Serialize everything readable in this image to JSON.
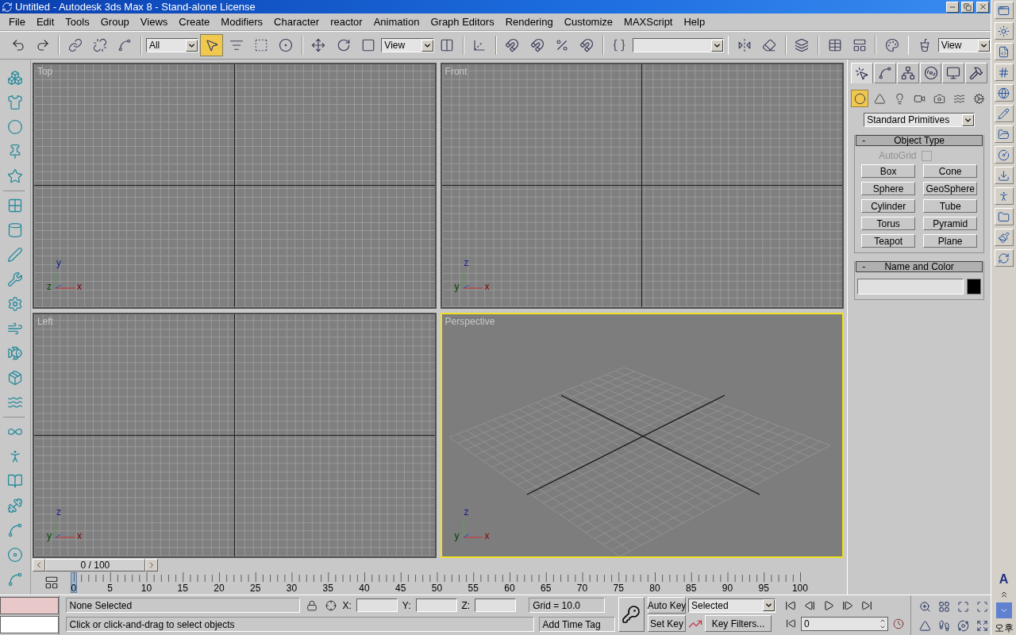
{
  "window": {
    "title": "Untitled - Autodesk 3ds Max 8  - Stand-alone License"
  },
  "menu": [
    "File",
    "Edit",
    "Tools",
    "Group",
    "Views",
    "Create",
    "Modifiers",
    "Character",
    "reactor",
    "Animation",
    "Graph Editors",
    "Rendering",
    "Customize",
    "MAXScript",
    "Help"
  ],
  "toolbar": {
    "selection_filter": "All",
    "reference_coordinate": "View",
    "render_view": "View",
    "tools": [
      {
        "selected": false
      },
      {
        "selected": false
      },
      {
        "selected": false
      },
      {
        "selected": false
      },
      {
        "selected": false
      },
      {
        "selected": true
      },
      {
        "selected": false
      },
      {
        "selected": false
      },
      {
        "selected": false
      },
      {
        "selected": false
      },
      {
        "selected": false
      },
      {
        "selected": false
      },
      {
        "selected": false
      },
      {
        "selected": false
      },
      {
        "selected": false
      },
      {
        "selected": false
      },
      {
        "selected": false
      },
      {
        "selected": false
      },
      {
        "selected": false
      },
      {
        "selected": false
      },
      {
        "selected": false
      },
      {
        "selected": false
      },
      {
        "selected": false
      },
      {
        "selected": false
      },
      {
        "selected": false
      },
      {
        "selected": false
      }
    ]
  },
  "viewports": [
    {
      "label": "Top",
      "active": false,
      "kind": "ortho",
      "axes": {
        "up": "y",
        "depth": "z",
        "right": "x"
      }
    },
    {
      "label": "Front",
      "active": false,
      "kind": "ortho",
      "axes": {
        "up": "z",
        "depth": "y",
        "right": "x"
      }
    },
    {
      "label": "Left",
      "active": false,
      "kind": "ortho",
      "axes": {
        "up": "z",
        "depth": "y",
        "right": "x"
      }
    },
    {
      "label": "Perspective",
      "active": true,
      "kind": "perspective",
      "axes": {
        "up": "z",
        "depth": "y",
        "right": "x"
      }
    }
  ],
  "command_panel": {
    "tabs": [
      {
        "selected": true
      },
      {
        "selected": false
      },
      {
        "selected": false
      },
      {
        "selected": false
      },
      {
        "selected": false
      },
      {
        "selected": false
      }
    ],
    "categories": [
      {
        "selected": true
      },
      {
        "selected": false
      },
      {
        "selected": false
      },
      {
        "selected": false
      },
      {
        "selected": false
      },
      {
        "selected": false
      },
      {
        "selected": false
      }
    ],
    "dropdown": "Standard Primitives",
    "object_type": {
      "collapse": "-",
      "title": "Object Type",
      "autogrid": {
        "label": "AutoGrid",
        "checked": false,
        "disabled": true
      },
      "buttons": [
        "Box",
        "Cone",
        "Sphere",
        "GeoSphere",
        "Cylinder",
        "Tube",
        "Torus",
        "Pyramid",
        "Teapot",
        "Plane"
      ]
    },
    "name_and_color": {
      "collapse": "-",
      "title": "Name and Color"
    }
  },
  "time_slider": {
    "label": "0 / 100",
    "ruler": [
      "0",
      "5",
      "10",
      "15",
      "20",
      "25",
      "30",
      "35",
      "40",
      "45",
      "50",
      "55",
      "60",
      "65",
      "70",
      "75",
      "80",
      "85",
      "90",
      "95",
      "100"
    ]
  },
  "status": {
    "selection": "None Selected",
    "prompt": "Click or click-and-drag to select objects",
    "x_label": "X:",
    "y_label": "Y:",
    "z_label": "Z:",
    "grid": "Grid = 10.0",
    "time_tag": "Add Time Tag"
  },
  "animation": {
    "auto_key": "Auto Key",
    "set_key": "Set Key",
    "key_set": "Selected",
    "key_filters": "Key Filters...",
    "frame": "0"
  },
  "taskbar": {
    "language": "A",
    "clock": "오후"
  }
}
